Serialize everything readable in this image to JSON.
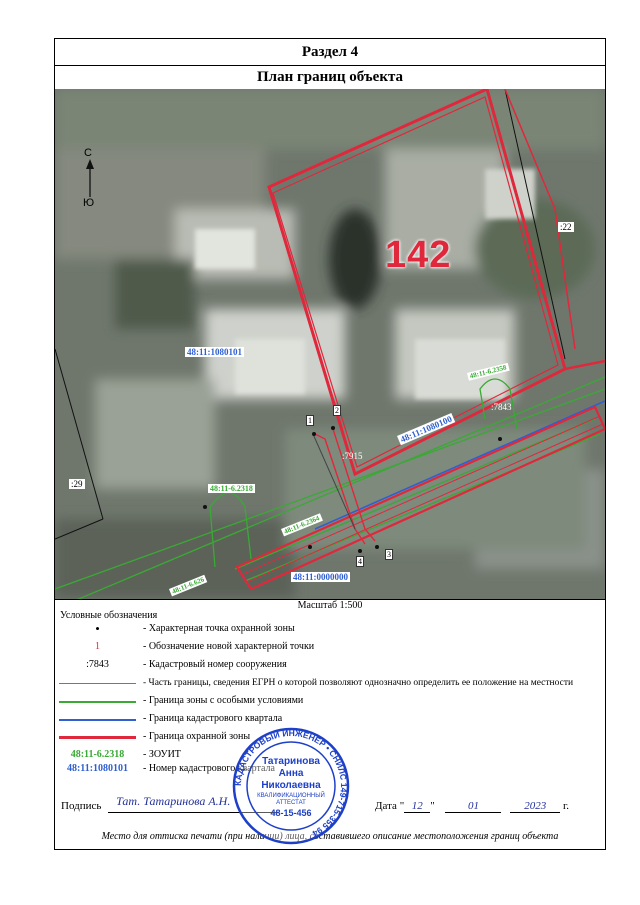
{
  "section_title": "Раздел 4",
  "plan_title": "План границ объекта",
  "map": {
    "compass_north": "С",
    "compass_south": "Ю",
    "house_number": "142",
    "labels": {
      "lot_22": ":22",
      "lot_29": ":29",
      "quarter_1080101": "48:11:1080101",
      "quarter_1080100": "48:11:1080100",
      "quarter_0000000": "48:11:0000000",
      "zone_2358": "48:11-6.2358",
      "zone_2318": "48:11-6.2318",
      "zone_2364": "48:11-6.2364",
      "zone_626": "48:11-6.626",
      "cad_7843": ":7843",
      "cad_7915": ":7915",
      "point_1": "1",
      "point_2": "2",
      "point_3": "3",
      "point_4": "4"
    }
  },
  "scale_text": "Масштаб 1:500",
  "legend_title": "Условные обозначения",
  "legend": [
    {
      "symbol": "•",
      "text": "- Характерная точка охранной зоны"
    },
    {
      "symbol": "1",
      "text": "- Обозначение новой характерной точки"
    },
    {
      "symbol": ":7843",
      "text": "- Кадастровый номер сооружения"
    },
    {
      "symbol": "",
      "text": "- Часть границы, сведения ЕГРН о которой позволяют однозначно определить ее положение на местности"
    },
    {
      "symbol": "",
      "text": "- Граница зоны с особыми условиями"
    },
    {
      "symbol": "",
      "text": "- Граница кадастрового квартала"
    },
    {
      "symbol": "",
      "text": "- Граница охранной зоны"
    },
    {
      "symbol": "48:11-6.2318",
      "text": "- ЗОУИТ"
    },
    {
      "symbol": "48:11:1080101",
      "text": "- Номер кадастрового квартала"
    }
  ],
  "colors": {
    "zone_green": "#3aa935",
    "quarter_blue": "#2f5fd0",
    "guard_red": "#e0283c",
    "egrn_gray": "#777777",
    "stamp_blue": "#1e40c8"
  },
  "signature": {
    "label": "Подпись",
    "handwriting": "Тат. Татаринова А.Н.",
    "date_label": "Дата",
    "day": "12",
    "month": "01",
    "year": "2023",
    "year_suffix": "г."
  },
  "stamp": {
    "name_line1": "Татаринова",
    "name_line2": "Анна",
    "name_line3": "Николаевна",
    "attestat_line1": "КВАЛИФИКАЦИОННЫЙ",
    "attestat_line2": "АТТЕСТАТ",
    "attestat_number": "48-15-456",
    "ring_text": "КАДАСТРОВЫЙ ИНЖЕНЕР • СНИЛС 149-715-355 94"
  },
  "footer": "Место для оттиска печати (при наличии) лица, составившего описание местоположения границ объекта"
}
